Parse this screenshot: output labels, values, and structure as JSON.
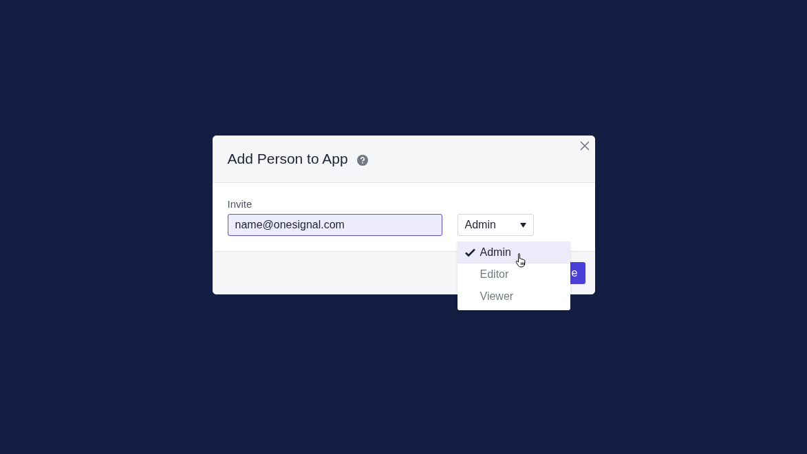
{
  "dialog": {
    "title": "Add Person to App",
    "invite_label": "Invite",
    "email_value": "name@onesignal.com",
    "role_select": "Admin",
    "submit_button": "e"
  },
  "role_menu": [
    {
      "label": "Admin",
      "selected": true
    },
    {
      "label": "Editor",
      "selected": false
    },
    {
      "label": "Viewer",
      "selected": false
    }
  ]
}
